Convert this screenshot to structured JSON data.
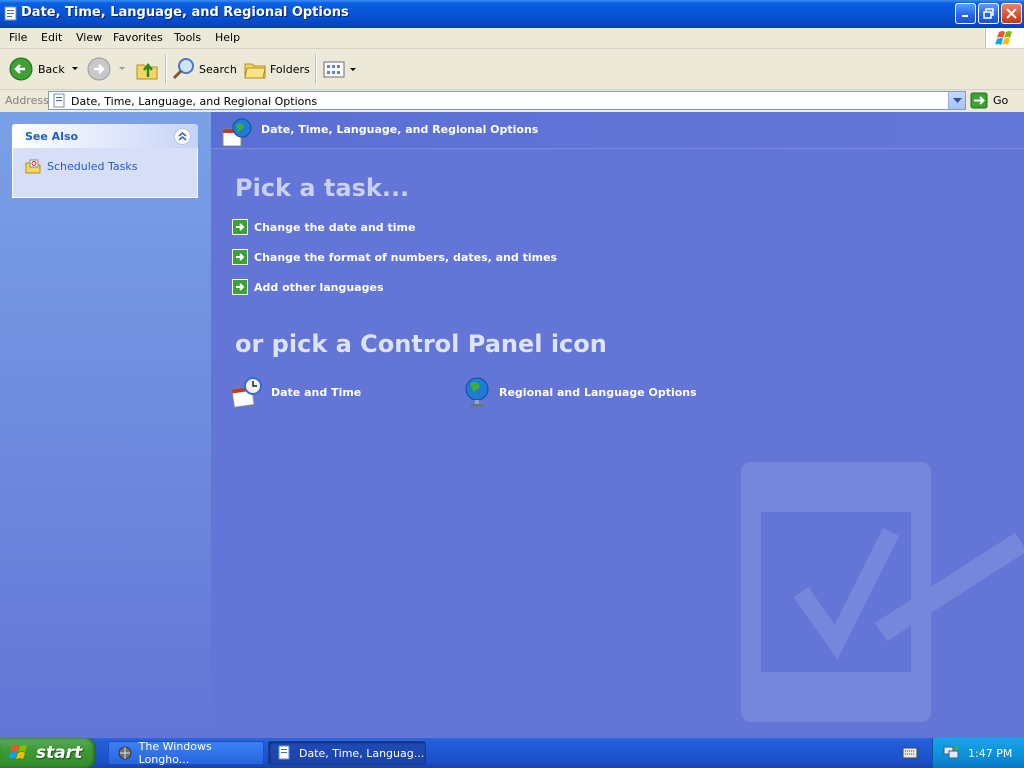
{
  "window": {
    "title": "Date, Time, Language, and Regional Options"
  },
  "menu": [
    "File",
    "Edit",
    "View",
    "Favorites",
    "Tools",
    "Help"
  ],
  "toolbar": {
    "back": "Back",
    "search": "Search",
    "folders": "Folders"
  },
  "address": {
    "label": "Address",
    "value": "Date, Time, Language, and Regional Options",
    "go": "Go"
  },
  "sidebar": {
    "see_also_title": "See Also",
    "items": [
      {
        "label": "Scheduled Tasks"
      }
    ]
  },
  "main": {
    "header_title": "Date, Time, Language, and Regional Options",
    "pick_task": "Pick a task...",
    "tasks": [
      {
        "label": "Change the date and time"
      },
      {
        "label": "Change the format of numbers, dates, and times"
      },
      {
        "label": "Add other languages"
      }
    ],
    "or_pick": "or pick a Control Panel icon",
    "icons": [
      {
        "label": "Date and Time",
        "icon": "clock-calendar-icon"
      },
      {
        "label": "Regional and Language Options",
        "icon": "globe-icon"
      }
    ]
  },
  "taskbar": {
    "start": "start",
    "buttons": [
      {
        "label": "The Windows Longho...",
        "active": false
      },
      {
        "label": "Date, Time, Languag...",
        "active": true
      }
    ],
    "clock": "1:47 PM"
  },
  "colors": {
    "title_bar": "#0854d6",
    "pane_background": "#6375d6",
    "start_green": "#3c9a34",
    "link_blue": "#215dc6"
  }
}
